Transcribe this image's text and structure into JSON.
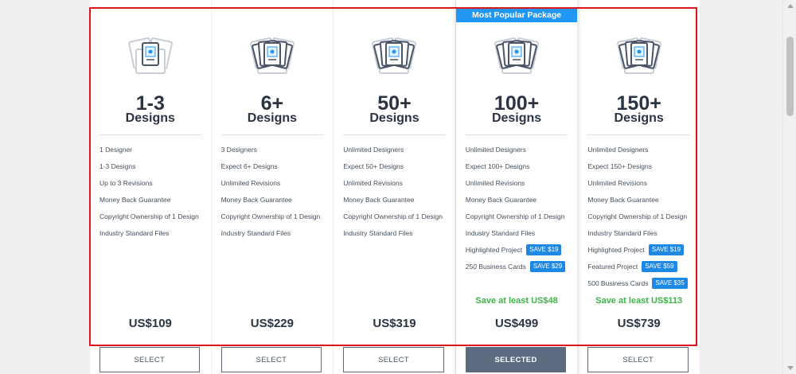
{
  "packages": [
    {
      "count": "1-3",
      "unit": "Designs",
      "icon": "single-document-icon",
      "features": [
        {
          "text": "1 Designer"
        },
        {
          "text": "1-3 Designs"
        },
        {
          "text": "Up to 3 Revisions"
        },
        {
          "text": "Money Back Guarantee"
        },
        {
          "text": "Copyright Ownership of 1 Design"
        },
        {
          "text": "Industry Standard Files"
        }
      ],
      "savings": "",
      "price": "US$109",
      "button": "SELECT",
      "selected": false
    },
    {
      "count": "6+",
      "unit": "Designs",
      "icon": "documents-stack-icon",
      "features": [
        {
          "text": "3 Designers"
        },
        {
          "text": "Expect 6+ Designs"
        },
        {
          "text": "Unlimited Revisions"
        },
        {
          "text": "Money Back Guarantee"
        },
        {
          "text": "Copyright Ownership of 1 Design"
        },
        {
          "text": "Industry Standard Files"
        }
      ],
      "savings": "",
      "price": "US$229",
      "button": "SELECT",
      "selected": false
    },
    {
      "count": "50+",
      "unit": "Designs",
      "icon": "documents-stack-icon",
      "features": [
        {
          "text": "Unlimited Designers"
        },
        {
          "text": "Expect 50+ Designs"
        },
        {
          "text": "Unlimited Revisions"
        },
        {
          "text": "Money Back Guarantee"
        },
        {
          "text": "Copyright Ownership of 1 Design"
        },
        {
          "text": "Industry Standard Files"
        }
      ],
      "savings": "",
      "price": "US$319",
      "button": "SELECT",
      "selected": false
    },
    {
      "banner": "Most Popular Package",
      "count": "100+",
      "unit": "Designs",
      "icon": "documents-stack-icon",
      "features": [
        {
          "text": "Unlimited Designers"
        },
        {
          "text": "Expect 100+ Designs"
        },
        {
          "text": "Unlimited Revisions"
        },
        {
          "text": "Money Back Guarantee"
        },
        {
          "text": "Copyright Ownership of 1 Design"
        },
        {
          "text": "Industry Standard Files"
        },
        {
          "text": "Highlighted Project",
          "badge": "SAVE $19"
        },
        {
          "text": "250 Business Cards",
          "badge": "SAVE $29"
        }
      ],
      "savings": "Save at least US$48",
      "price": "US$499",
      "button": "SELECTED",
      "selected": true
    },
    {
      "count": "150+",
      "unit": "Designs",
      "icon": "documents-stack-icon",
      "features": [
        {
          "text": "Unlimited Designers"
        },
        {
          "text": "Expect 150+ Designs"
        },
        {
          "text": "Unlimited Revisions"
        },
        {
          "text": "Money Back Guarantee"
        },
        {
          "text": "Copyright Ownership of 1 Design"
        },
        {
          "text": "Industry Standard Files"
        },
        {
          "text": "Highlighted Project",
          "badge": "SAVE $19"
        },
        {
          "text": "Featured Project",
          "badge": "SAVE $59"
        },
        {
          "text": "500 Business Cards",
          "badge": "SAVE $35"
        }
      ],
      "savings": "Save at least US$113",
      "price": "US$739",
      "button": "SELECT",
      "selected": false
    }
  ],
  "colors": {
    "banner": "#2196f3",
    "badge": "#1e88e5",
    "savings": "#3cb34a",
    "selected_button": "#5c6b80",
    "highlight_frame": "#e0161e"
  }
}
